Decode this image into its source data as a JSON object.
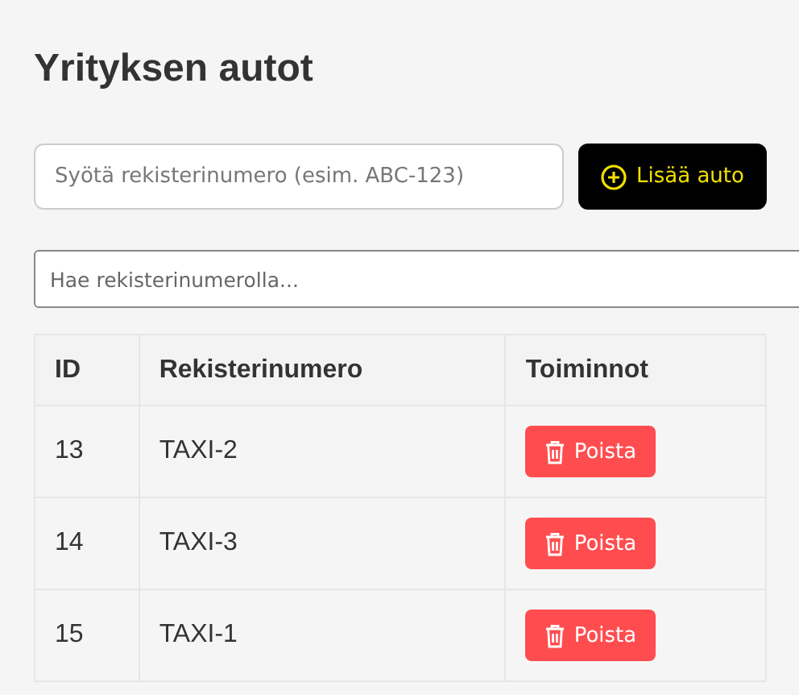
{
  "title": "Yrityksen autot",
  "add_form": {
    "placeholder": "Syötä rekisterinumero (esim. ABC-123)",
    "button": "Lisää auto"
  },
  "search": {
    "placeholder": "Hae rekisterinumerolla..."
  },
  "table": {
    "columns": [
      "ID",
      "Rekisterinumero",
      "Toiminnot"
    ],
    "rows": [
      {
        "id": "13",
        "plate": "TAXI-2",
        "action": "Poista"
      },
      {
        "id": "14",
        "plate": "TAXI-3",
        "action": "Poista"
      },
      {
        "id": "15",
        "plate": "TAXI-1",
        "action": "Poista"
      }
    ]
  }
}
